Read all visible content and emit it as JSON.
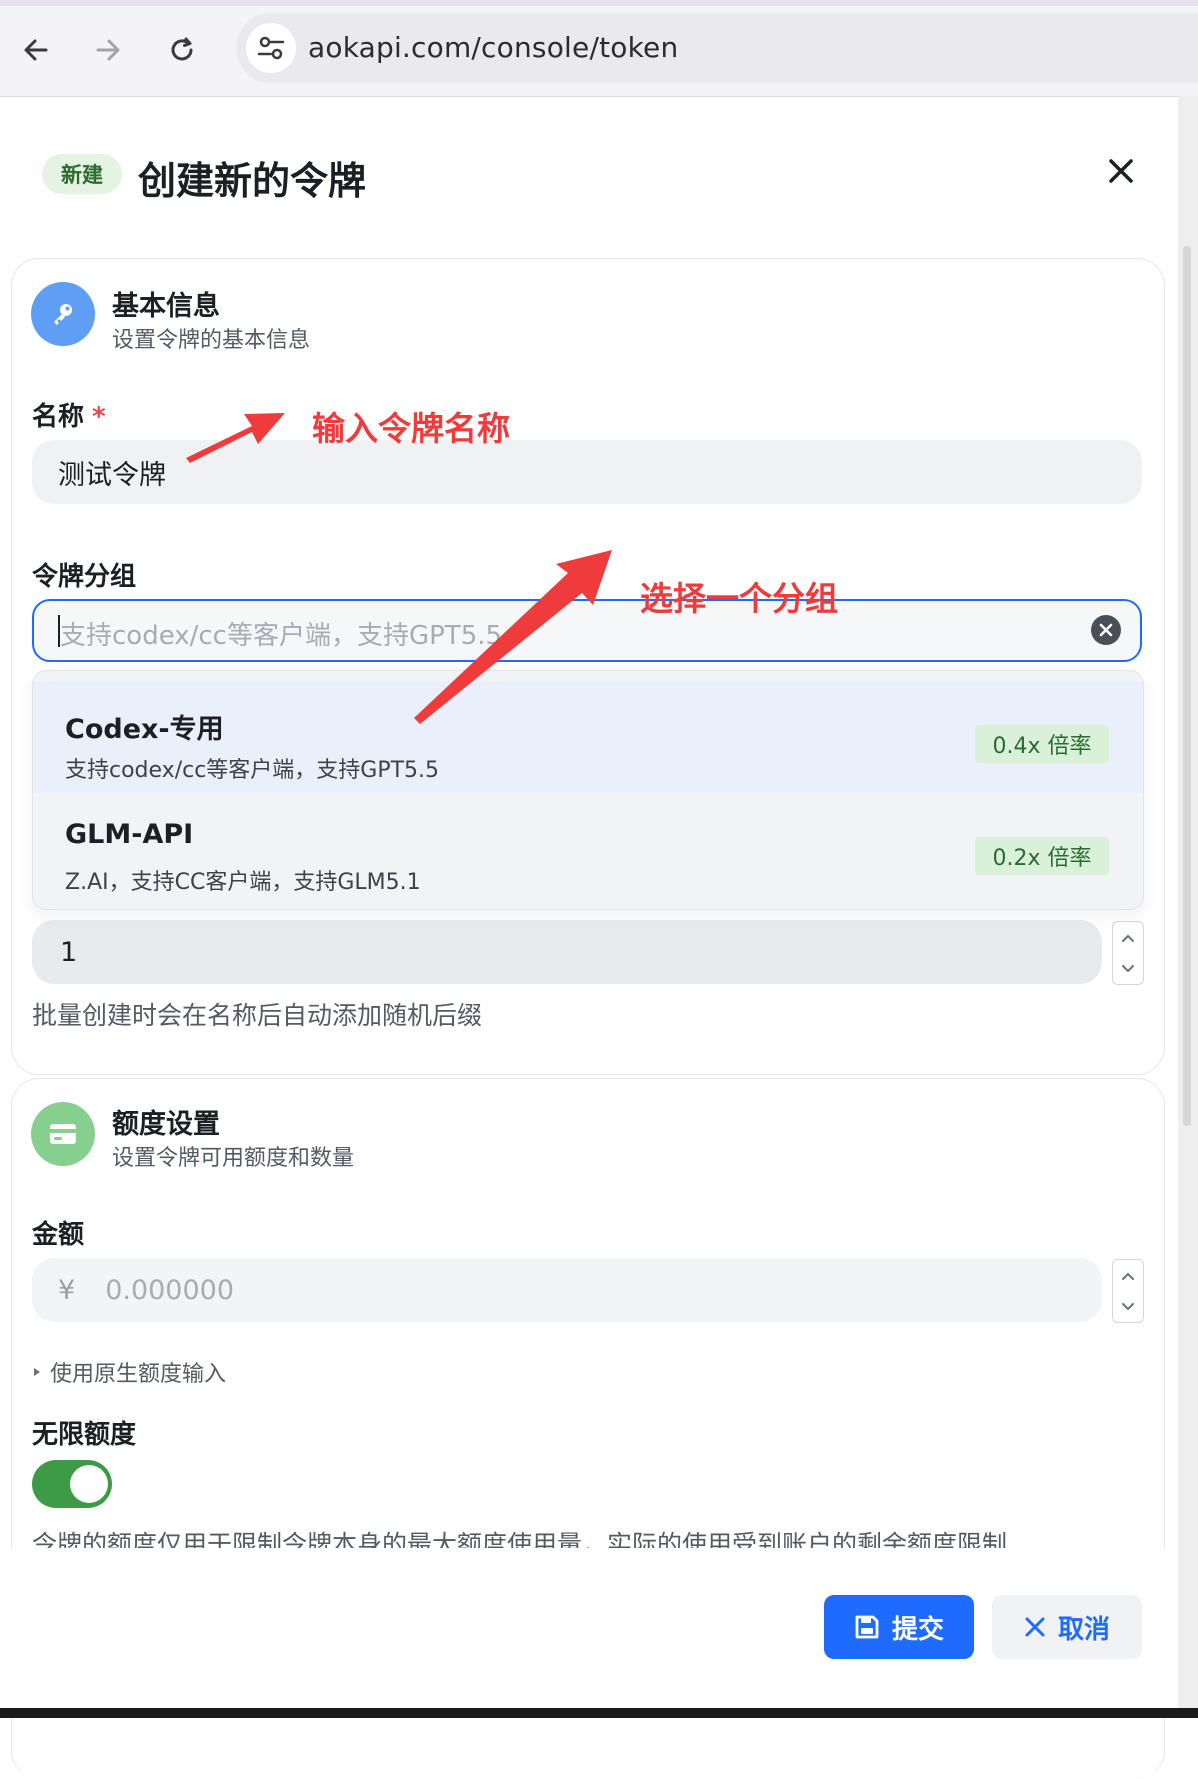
{
  "browser": {
    "url": "aokapi.com/console/token",
    "back_icon": "arrow-left-icon",
    "forward_icon": "arrow-right-icon",
    "reload_icon": "reload-icon",
    "site_settings_icon": "tune-icon"
  },
  "dialog": {
    "badge": "新建",
    "title": "创建新的令牌",
    "close_icon": "close-icon"
  },
  "basic": {
    "title": "基本信息",
    "subtitle": "设置令牌的基本信息",
    "icon": "key-icon",
    "name_label": "名称",
    "required_mark": "*",
    "name_value": "测试令牌",
    "group_label": "令牌分组",
    "group_placeholder": "支持codex/cc等客户端，支持GPT5.5",
    "group_options": [
      {
        "name": "Codex-专用",
        "desc": "支持codex/cc等客户端，支持GPT5.5",
        "rate": "0.4x 倍率",
        "selected": true
      },
      {
        "name": "GLM-API",
        "desc": "Z.AI，支持CC客户端，支持GLM5.1",
        "rate": "0.2x 倍率",
        "selected": false
      }
    ],
    "quantity_value": "1",
    "quantity_help": "批量创建时会在名称后自动添加随机后缀"
  },
  "quota": {
    "title": "额度设置",
    "subtitle": "设置令牌可用额度和数量",
    "icon": "credit-card-icon",
    "amount_label": "金额",
    "currency_symbol": "¥",
    "amount_placeholder": "0.000000",
    "native_input_toggle": "使用原生额度输入",
    "unlimited_label": "无限额度",
    "unlimited_on": true,
    "note": "令牌的额度仅用于限制令牌本身的最大额度使用量，实际的使用受到账户的剩余额度限制"
  },
  "footer": {
    "submit_label": "提交",
    "cancel_label": "取消",
    "submit_icon": "save-icon",
    "cancel_icon": "close-icon"
  },
  "annotations": {
    "name_hint": "输入令牌名称",
    "group_hint": "选择一个分组"
  },
  "colors": {
    "primary": "#1f6bff",
    "annotation": "#ef3b3b",
    "toggle_on": "#3d9a45",
    "rate_badge_bg": "#d9f0d9"
  }
}
